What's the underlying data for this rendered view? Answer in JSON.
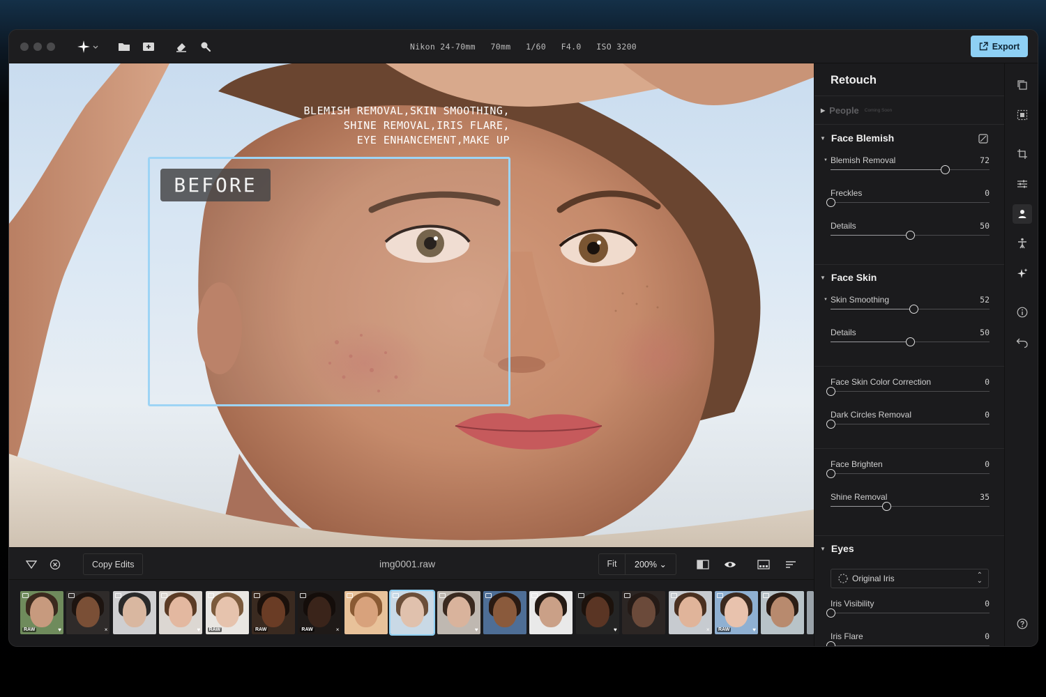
{
  "toolbar": {
    "exif": "Nikon 24-70mm   70mm   1/60   F4.0   ISO 3200",
    "export_label": "Export"
  },
  "photo": {
    "overlay_text": "BLEMISH REMOVAL,SKIN SMOOTHING,\nSHINE REMOVAL,IRIS FLARE,\nEYE ENHANCEMENT,MAKE UP",
    "before_label": "BEFORE"
  },
  "bottom": {
    "copy_edits": "Copy Edits",
    "filename": "img0001.raw",
    "fit": "Fit",
    "zoom": "200% ⌄"
  },
  "filmstrip": [
    {
      "raw": "RAW",
      "mark": "♥",
      "face": "#c79a7e",
      "hair": "#3b2a1e",
      "bg": "#6f8b5c"
    },
    {
      "raw": "",
      "mark": "×",
      "face": "#7a4f36",
      "hair": "#1d1410",
      "bg": "#2f2b2a"
    },
    {
      "raw": "",
      "mark": "",
      "face": "#d9b7a0",
      "hair": "#2a2a2a",
      "bg": "#cfcfd1"
    },
    {
      "raw": "",
      "mark": "♥",
      "face": "#e3b8a0",
      "hair": "#5b3b25",
      "bg": "#dcd7d2"
    },
    {
      "raw": "RAW",
      "mark": "",
      "face": "#e6c3ad",
      "hair": "#7b5a3c",
      "bg": "#e9e6e2"
    },
    {
      "raw": "RAW",
      "mark": "",
      "face": "#6a3c25",
      "hair": "#1a100b",
      "bg": "#3a2a20"
    },
    {
      "raw": "RAW",
      "mark": "×",
      "face": "#3a241a",
      "hair": "#140d0a",
      "bg": "#1f1a18"
    },
    {
      "raw": "",
      "mark": "",
      "face": "#d8a27c",
      "hair": "#8a5a33",
      "bg": "#e8c29a"
    },
    {
      "raw": "",
      "mark": "",
      "face": "#e0c1ad",
      "hair": "#6b4e39",
      "bg": "#c9d9e6",
      "selected": true
    },
    {
      "raw": "",
      "mark": "♥",
      "face": "#d9b39c",
      "hair": "#3a2a20",
      "bg": "#bfb8b1"
    },
    {
      "raw": "",
      "mark": "",
      "face": "#8a5a3c",
      "hair": "#2a1a12",
      "bg": "#4e6e96"
    },
    {
      "raw": "",
      "mark": "",
      "face": "#caa087",
      "hair": "#241a14",
      "bg": "#e9e9e9"
    },
    {
      "raw": "",
      "mark": "♥",
      "face": "#5a3524",
      "hair": "#1c120c",
      "bg": "#242424"
    },
    {
      "raw": "",
      "mark": "",
      "face": "#6b4a3a",
      "hair": "#241a16",
      "bg": "#2c2624"
    },
    {
      "raw": "",
      "mark": "×",
      "face": "#e0b49a",
      "hair": "#4a3020",
      "bg": "#c7cbd0"
    },
    {
      "raw": "RAW",
      "mark": "♥",
      "face": "#e8c2ad",
      "hair": "#3b2a20",
      "bg": "#8fb0d2"
    },
    {
      "raw": "",
      "mark": "",
      "face": "#b88a6e",
      "hair": "#2b1d15",
      "bg": "#b8c3c8"
    }
  ],
  "panel": {
    "title": "Retouch",
    "people": "People",
    "coming_soon": "Coming Soon",
    "face_blemish": {
      "title": "Face Blemish",
      "sliders": [
        {
          "label": "Blemish Removal",
          "value": "72",
          "level": 0.72,
          "sub": true
        },
        {
          "label": "Freckles",
          "value": "0",
          "level": 0,
          "sub": false
        },
        {
          "label": "Details",
          "value": "50",
          "level": 0.5,
          "sub": false
        }
      ]
    },
    "face_skin": {
      "title": "Face Skin",
      "sliders": [
        {
          "label": "Skin Smoothing",
          "value": "52",
          "level": 0.52,
          "sub": true
        },
        {
          "label": "Details",
          "value": "50",
          "level": 0.5,
          "sub": false
        },
        {
          "label": "Face Skin Color Correction",
          "value": "0",
          "level": 0,
          "sub": false
        },
        {
          "label": "Dark Circles Removal",
          "value": "0",
          "level": 0,
          "sub": false
        },
        {
          "label": "Face Brighten",
          "value": "0",
          "level": 0,
          "sub": false
        },
        {
          "label": "Shine Removal",
          "value": "35",
          "level": 0.35,
          "sub": false
        }
      ]
    },
    "eyes": {
      "title": "Eyes",
      "select": "Original Iris",
      "sliders": [
        {
          "label": "Iris Visibility",
          "value": "0",
          "level": 0,
          "sub": false
        },
        {
          "label": "Iris Flare",
          "value": "0",
          "level": 0,
          "sub": false
        }
      ]
    }
  },
  "colors": {
    "accent": "#8ed0f4",
    "panel_bg": "#1b1b1d"
  }
}
